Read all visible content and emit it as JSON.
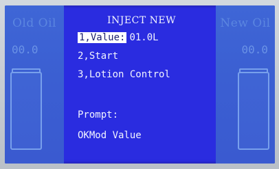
{
  "left_panel": {
    "title": "Old Oil",
    "value": "00.0"
  },
  "right_panel": {
    "title": "New Oil",
    "value": "00.0"
  },
  "menu": {
    "title": "INJECT NEW",
    "item_value_label": "1,Value:",
    "item_value_value": "01.0L",
    "item_start_label": "2,Start",
    "item_lotion_label": "3,Lotion Control"
  },
  "prompt": {
    "label": "Prompt:",
    "text": "OKMod Value"
  },
  "colors": {
    "screen_background": "#2a2ce0",
    "side_panel": "#3f66d6",
    "text": "#f2f4ff",
    "highlight": "#ffffff"
  },
  "icons": [
    "oil-tank-icon",
    "oil-tank-icon"
  ]
}
